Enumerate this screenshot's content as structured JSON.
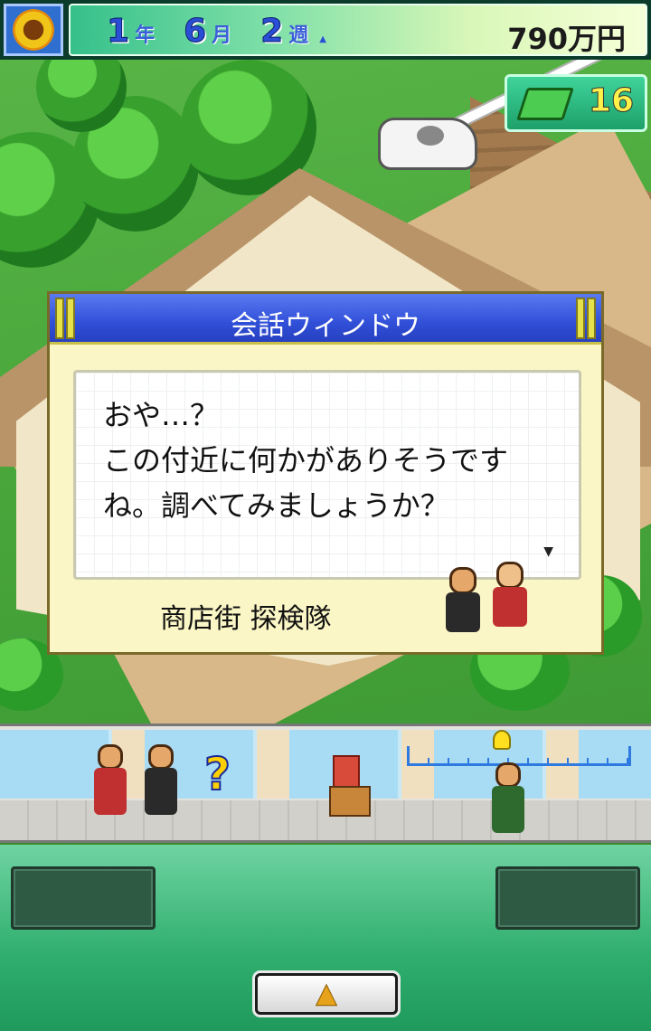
{
  "header": {
    "year": "1",
    "year_unit": "年",
    "month": "6",
    "month_unit": "月",
    "week": "2",
    "week_unit": "週",
    "money": "790万円"
  },
  "gems": {
    "count": "16",
    "icon": "book-icon"
  },
  "dialog": {
    "title": "会話ウィンドウ",
    "lines": [
      "おや…？",
      "この付近に何かがありそうです",
      "ね。調べてみましょうか？"
    ],
    "speaker": "商店街 探検隊"
  },
  "street": {
    "marker": "?",
    "progress": 0.42
  },
  "bottom": {
    "up_icon": "up-arrow-icon",
    "up_glyph": "▲"
  },
  "colors": {
    "title_bar": "#3150d8",
    "accent": "#ffd000",
    "panel": "#2fae6e"
  }
}
